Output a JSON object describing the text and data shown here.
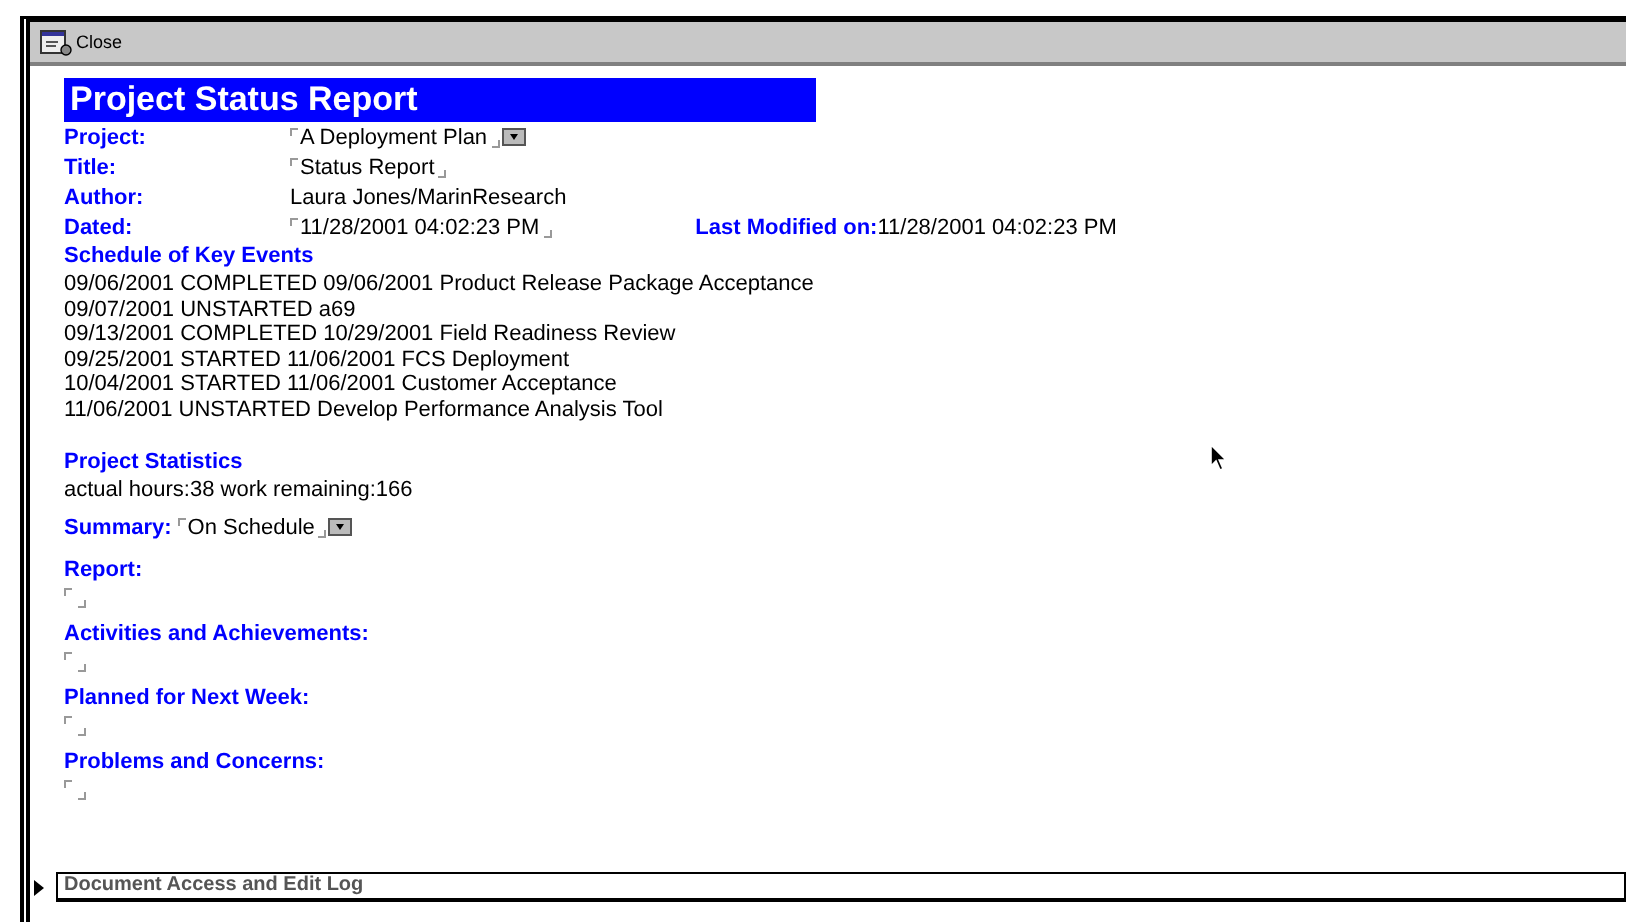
{
  "toolbar": {
    "close_label": "Close"
  },
  "form_title": "Project Status Report",
  "fields": [
    {
      "label": "Project:",
      "value": "A Deployment Plan",
      "kind": "dropdown"
    },
    {
      "label": "Title:",
      "value": "Status Report",
      "kind": "text"
    },
    {
      "label": "Author:",
      "value": "Laura Jones/MarinResearch",
      "kind": "plain"
    },
    {
      "label": "Dated:",
      "value": "11/28/2001 04:02:23 PM",
      "kind": "text"
    }
  ],
  "last_modified": {
    "label": "Last Modified on:",
    "value": "11/28/2001 04:02:23 PM"
  },
  "schedule": {
    "heading": "Schedule of Key Events",
    "events": [
      "09/06/2001 COMPLETED 09/06/2001 Product Release Package Acceptance",
      "09/07/2001 UNSTARTED a69",
      "09/13/2001 COMPLETED 10/29/2001 Field Readiness Review",
      "09/25/2001 STARTED 11/06/2001 FCS Deployment",
      "10/04/2001 STARTED 11/06/2001 Customer Acceptance",
      "11/06/2001 UNSTARTED Develop Performance Analysis Tool"
    ]
  },
  "statistics": {
    "heading": "Project Statistics",
    "text": "actual hours:38  work remaining:166"
  },
  "summary": {
    "label": "Summary:",
    "value": "On Schedule"
  },
  "sections": [
    {
      "label": "Report:"
    },
    {
      "label": "Activities and Achievements:"
    },
    {
      "label": "Planned for Next Week:"
    },
    {
      "label": "Problems and Concerns:"
    }
  ],
  "collapsed_section": {
    "title": "Document Access and Edit Log",
    "expanded": false
  }
}
